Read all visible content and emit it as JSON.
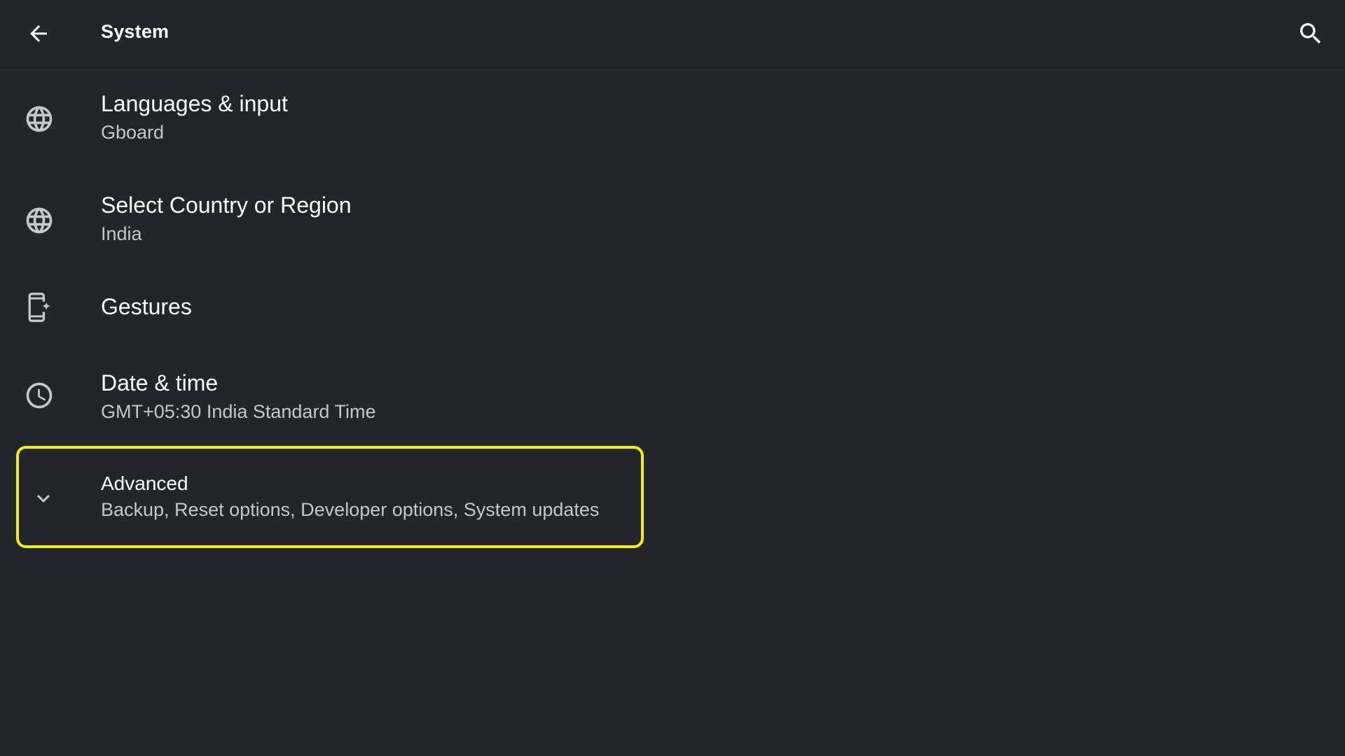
{
  "toolbar": {
    "title": "System",
    "back_icon": "arrow-back-icon",
    "search_icon": "search-icon"
  },
  "items": [
    {
      "title": "Languages & input",
      "summary": "Gboard",
      "icon": "globe-icon"
    },
    {
      "title": "Select Country or Region",
      "summary": "India",
      "icon": "globe-icon"
    },
    {
      "title": "Gestures",
      "summary": "",
      "icon": "gestures-phone-icon"
    },
    {
      "title": "Date & time",
      "summary": "GMT+05:30 India Standard Time",
      "icon": "clock-icon"
    }
  ],
  "advanced": {
    "title": "Advanced",
    "summary": "Backup, Reset options, Developer options, System updates",
    "icon": "chevron-down-icon",
    "highlight_color": "#f2f200"
  },
  "colors": {
    "background": "#22262b",
    "text_primary": "#ffffff",
    "text_secondary": "#c4c7cc",
    "icon": "#c4c7cc"
  }
}
